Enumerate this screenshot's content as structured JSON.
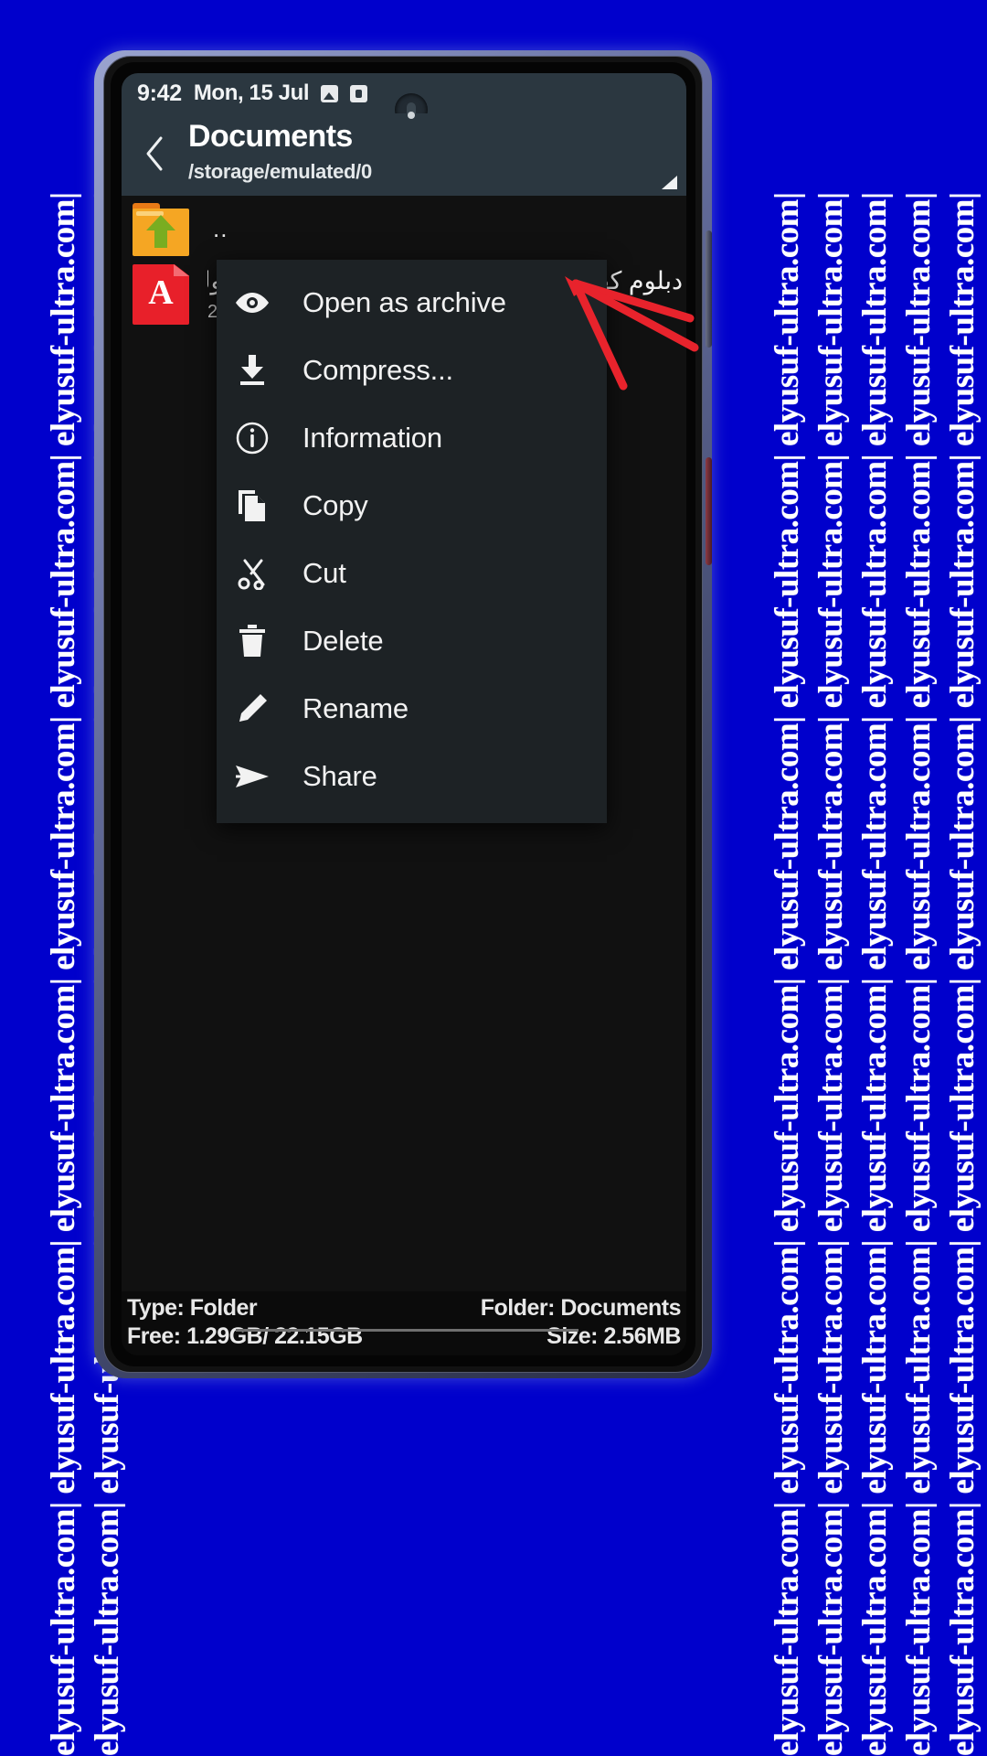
{
  "watermark": {
    "text": "elyusuf-ultra.com| elyusuf-ultra.com| elyusuf-ultra.com| elyusuf-ultra.com| elyusuf-ultra.com| elyusuf-ultra.com|",
    "color": "#ffffff",
    "background": "#0000cc"
  },
  "statusbar": {
    "time": "9:42",
    "date": "Mon, 15 Jul",
    "icons": [
      "photo-icon",
      "app-icon"
    ]
  },
  "toolbar": {
    "back_icon": "back-chevron-icon",
    "title": "Documents",
    "path": "/storage/emulated/0",
    "resize_corner_icon": "resize-corner-icon"
  },
  "filelist": {
    "rows": [
      {
        "icon": "folder-up-icon",
        "name": "..",
        "size": ""
      },
      {
        "icon": "pdf-file-icon",
        "name": "دبلوم كفر - 1 ابتدائي - ترم 2 - مذكرة 1 - ذاكرولي.pdf",
        "size": "2.56"
      }
    ]
  },
  "context_menu": {
    "items": [
      {
        "icon": "eye-icon",
        "label": "Open as archive"
      },
      {
        "icon": "download-icon",
        "label": "Compress..."
      },
      {
        "icon": "info-icon",
        "label": "Information"
      },
      {
        "icon": "copy-icon",
        "label": "Copy"
      },
      {
        "icon": "scissors-icon",
        "label": "Cut"
      },
      {
        "icon": "trash-icon",
        "label": "Delete"
      },
      {
        "icon": "pencil-icon",
        "label": "Rename"
      },
      {
        "icon": "send-icon",
        "label": "Share"
      }
    ]
  },
  "bottombar": {
    "type_label": "Type: Folder",
    "free_label": "Free: 1.29GB/ 22.15GB",
    "folder_label": "Folder: Documents",
    "size_label": "Size: 2.56MB"
  },
  "annotation": {
    "color": "#e8232c",
    "shape": "arrow-pointing-left"
  }
}
